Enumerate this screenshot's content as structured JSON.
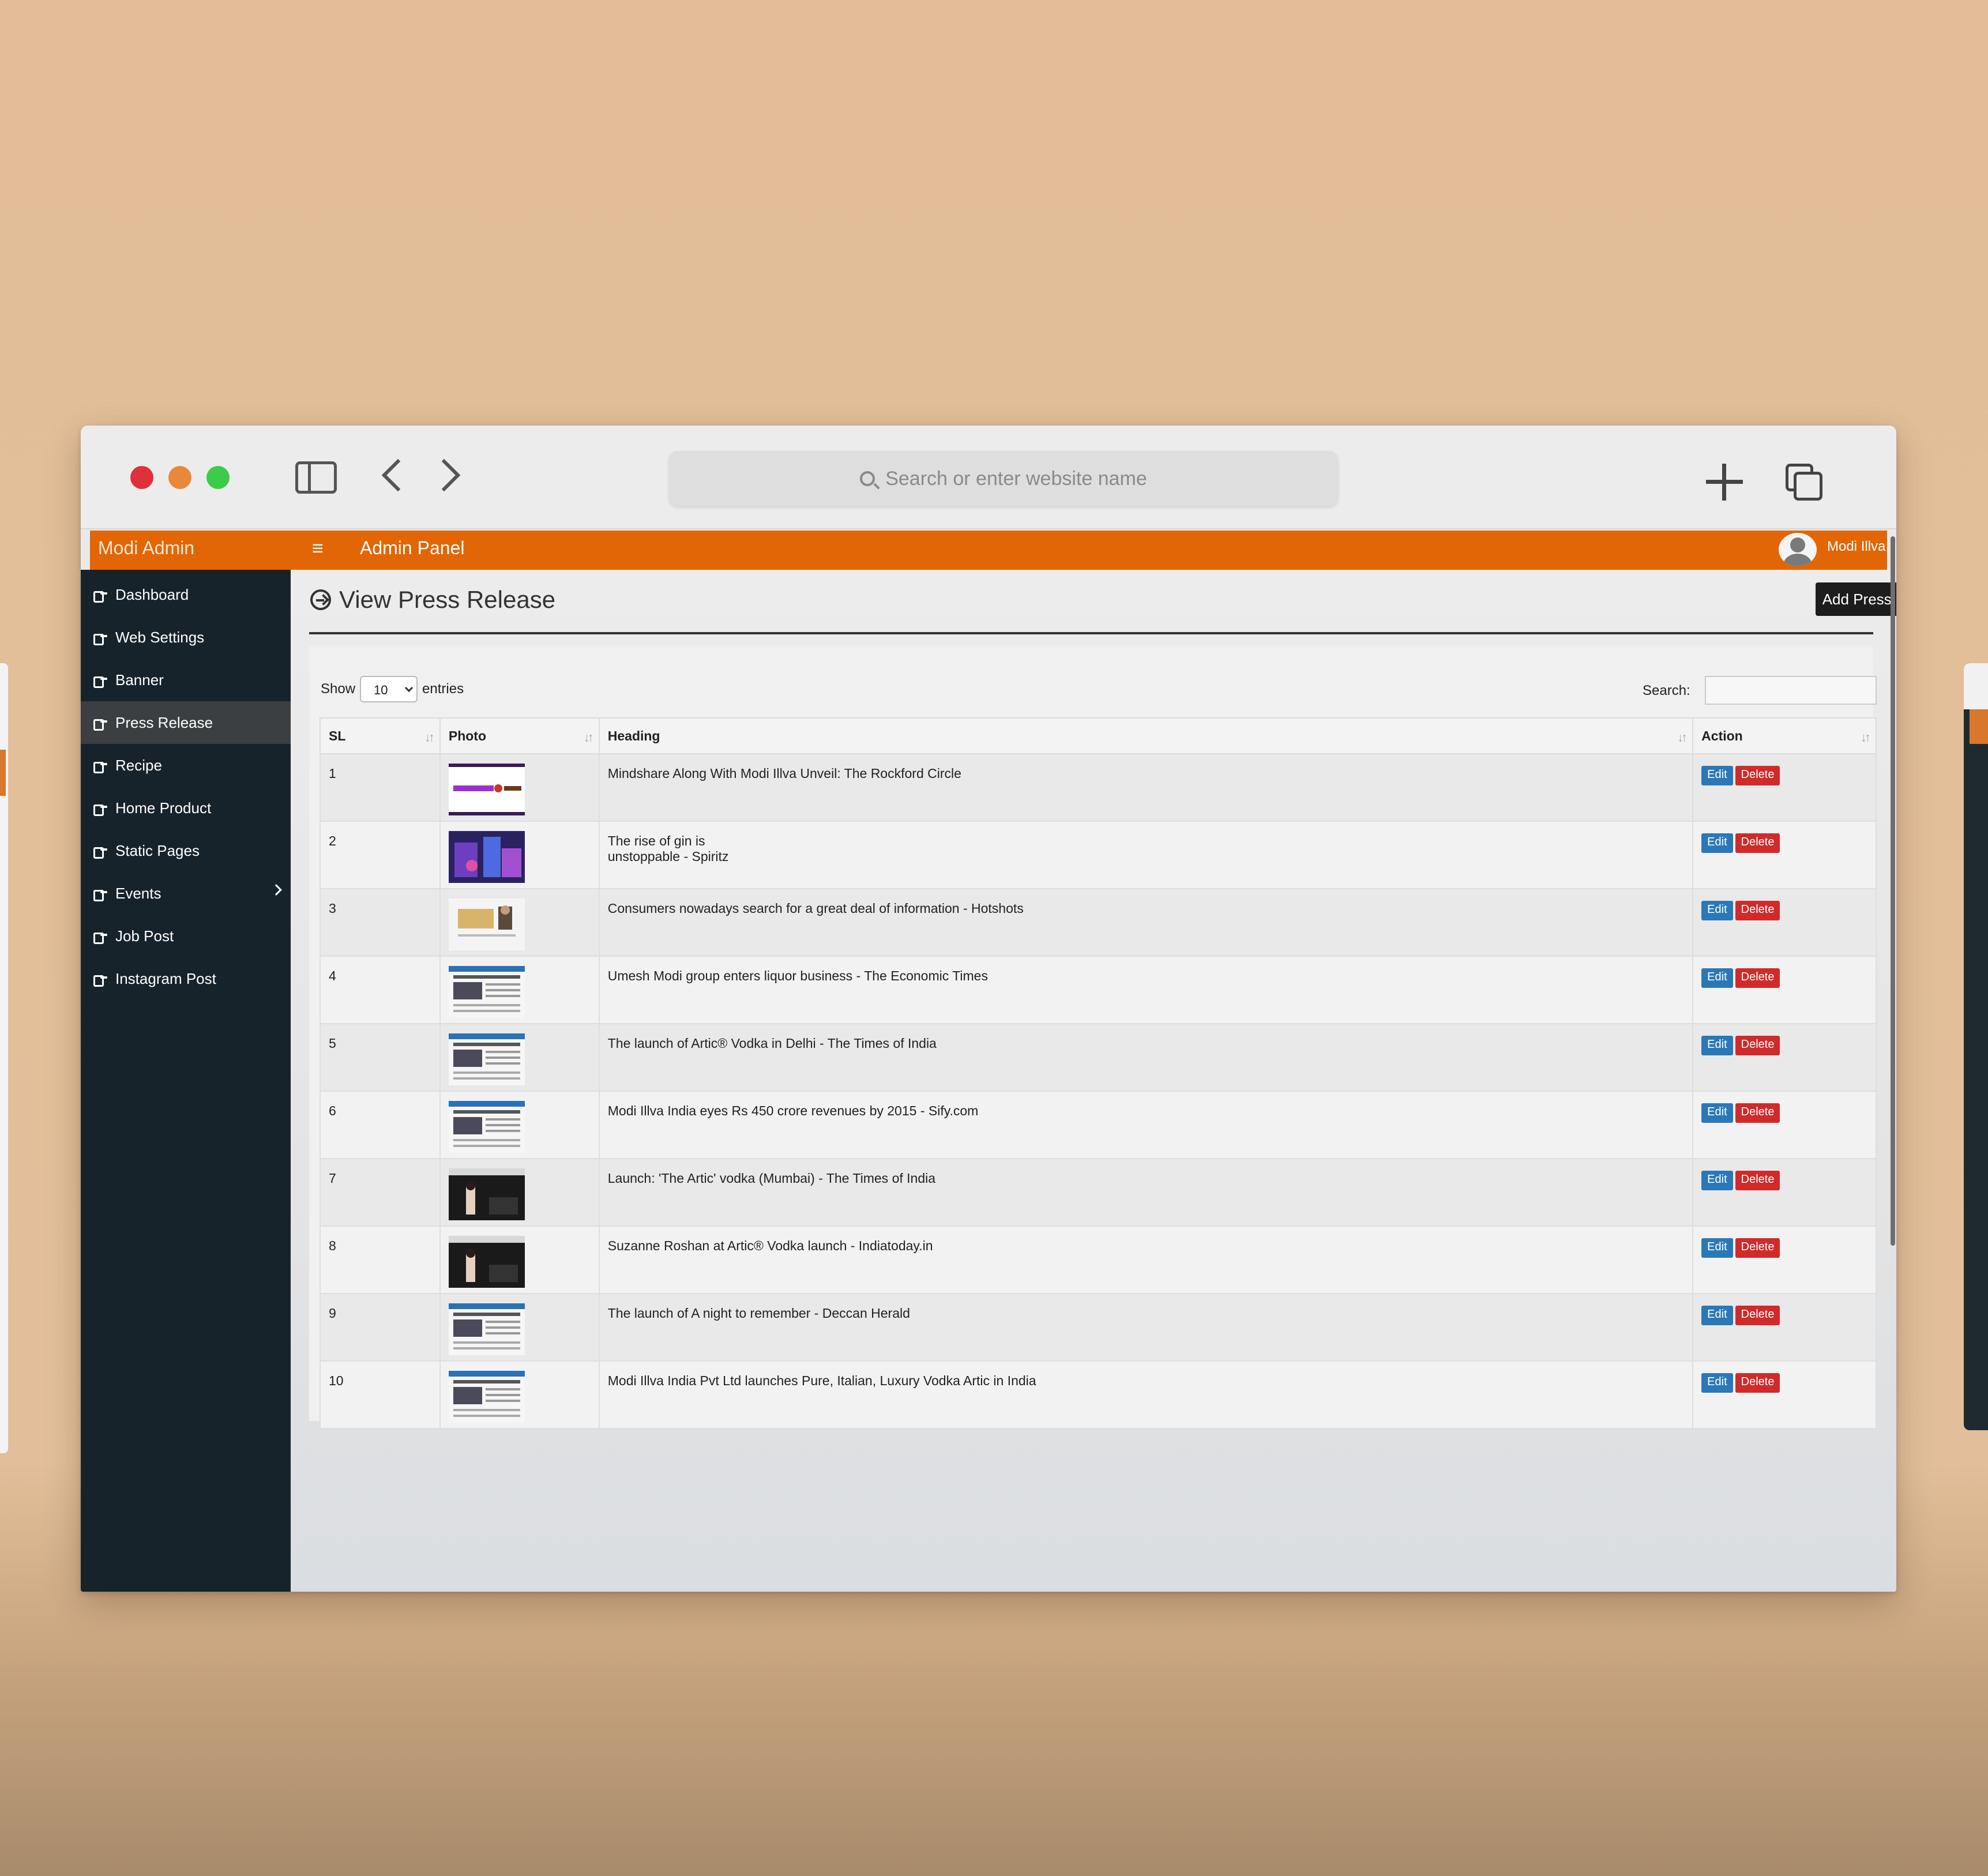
{
  "browser": {
    "url_placeholder": "Search or enter website name"
  },
  "app": {
    "brand": "Modi Admin",
    "panel_title": "Admin Panel",
    "hamburger": "≡",
    "user_name": "Modi Illva",
    "accent_color": "#e26605",
    "sidebar_color": "#16232a"
  },
  "sidebar": {
    "items": [
      {
        "label": "Dashboard"
      },
      {
        "label": "Web Settings"
      },
      {
        "label": "Banner"
      },
      {
        "label": "Press Release",
        "active": true
      },
      {
        "label": "Recipe"
      },
      {
        "label": "Home Product"
      },
      {
        "label": "Static Pages"
      },
      {
        "label": "Events",
        "has_submenu": true
      },
      {
        "label": "Job Post"
      },
      {
        "label": "Instagram Post"
      }
    ]
  },
  "page": {
    "title": "View Press Release",
    "add_button": "Add Press Release"
  },
  "table_controls": {
    "show_label": "Show",
    "page_size": "10",
    "entries_label": "entries",
    "search_label": "Search:"
  },
  "table": {
    "columns": [
      "SL",
      "Photo",
      "Heading",
      "Action"
    ],
    "edit_label": "Edit",
    "delete_label": "Delete",
    "rows": [
      {
        "sl": "1",
        "heading": "Mindshare Along With Modi Illva Unveil: The Rockford Circle",
        "photo": "thumb-logo"
      },
      {
        "sl": "2",
        "heading_lines": [
          "The rise of gin is",
          "unstoppable - Spiritz"
        ],
        "photo": "thumb-stage"
      },
      {
        "sl": "3",
        "heading": "Consumers nowadays search for a great deal of information - Hotshots",
        "photo": "thumb-quote"
      },
      {
        "sl": "4",
        "heading": "Umesh Modi group enters liquor business - The Economic Times",
        "photo": "thumb-news"
      },
      {
        "sl": "5",
        "heading": "The launch of Artic® Vodka in Delhi - The Times of India",
        "photo": "thumb-news"
      },
      {
        "sl": "6",
        "heading": "Modi Illva India eyes Rs 450 crore revenues by 2015 - Sify.com",
        "photo": "thumb-news"
      },
      {
        "sl": "7",
        "heading": "Launch: 'The Artic' vodka (Mumbai) - The Times of India",
        "photo": "thumb-dark"
      },
      {
        "sl": "8",
        "heading": "Suzanne Roshan at Artic® Vodka launch - Indiatoday.in",
        "photo": "thumb-dark"
      },
      {
        "sl": "9",
        "heading": "The launch of A night to remember - Deccan Herald",
        "photo": "thumb-news"
      },
      {
        "sl": "10",
        "heading": "Modi Illva India Pvt Ltd launches Pure, Italian, Luxury Vodka Artic in India",
        "photo": "thumb-news"
      }
    ]
  }
}
